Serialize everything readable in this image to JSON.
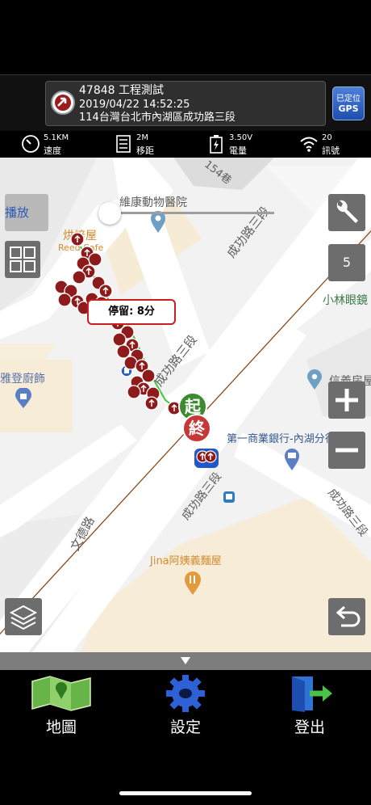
{
  "vehicle": {
    "id_name": "47848 工程測試",
    "datetime": "2019/04/22 14:52:25",
    "address": "114台灣台北市內湖區成功路三段"
  },
  "gps_button": {
    "line1": "已定位",
    "line2": "GPS"
  },
  "stats": [
    {
      "value": "5.1KM",
      "label": "速度",
      "icon": "speedometer-icon"
    },
    {
      "value": "2M",
      "label": "移距",
      "icon": "distance-icon"
    },
    {
      "value": "3.50V",
      "label": "電量",
      "icon": "battery-icon"
    },
    {
      "value": "20",
      "label": "訊號",
      "icon": "wifi-signal-icon"
    }
  ],
  "map": {
    "play_label": "播放",
    "zoom_level": "5",
    "popup": "停留: 8分",
    "marker_start": "起",
    "marker_end": "終",
    "labels": {
      "vet": "維康動物醫院",
      "cafe": "烘焙屋",
      "cafe_en": "Reed Cafe",
      "road_cg1": "成功路三段",
      "road_cg2": "成功路三段",
      "road_cg3": "成功路三段",
      "road_cg4": "成功路三段",
      "wende": "文德路",
      "restaurant": "雅登廚飾",
      "optics": "小林眼鏡",
      "xinyi": "信義房屋",
      "bank": "第一商業銀行-內湖分行",
      "noodle": "Jina阿姨義麵屋",
      "lane": "154巷",
      "bottom_road": "成功路三段"
    }
  },
  "nav": [
    {
      "label": "地圖",
      "icon": "map-icon"
    },
    {
      "label": "設定",
      "icon": "gear-icon"
    },
    {
      "label": "登出",
      "icon": "logout-door-icon"
    }
  ],
  "colors": {
    "route_red": "#9b1c1c",
    "route_green": "#3cc83c",
    "start": "#3c8b2e",
    "end": "#c63838"
  }
}
